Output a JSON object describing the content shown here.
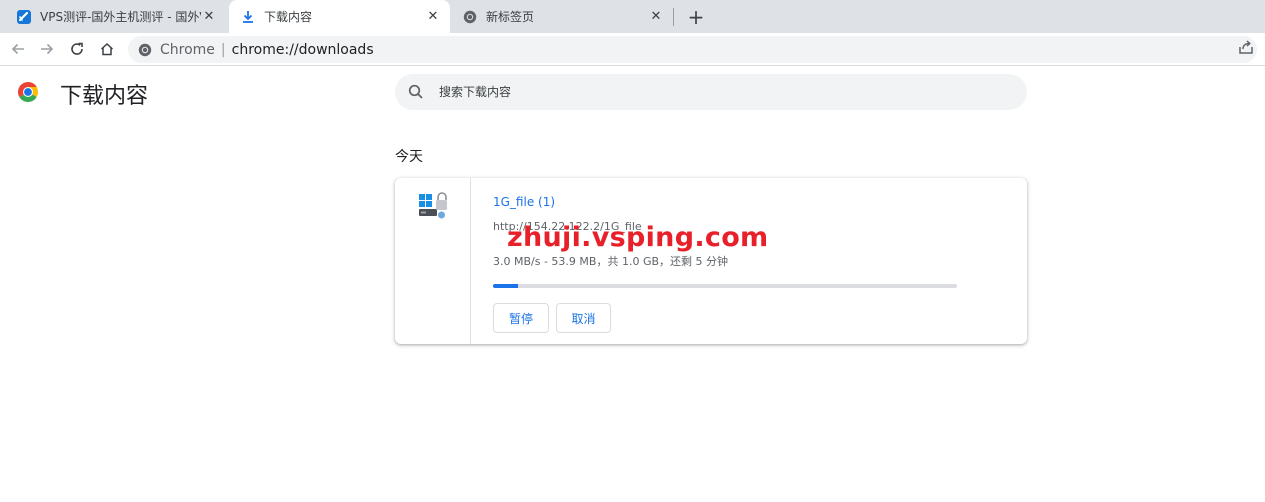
{
  "tabs": [
    {
      "title": "VPS测评-国外主机测评 - 国外VP",
      "close": "✕",
      "active": false
    },
    {
      "title": "下载内容",
      "close": "✕",
      "active": true
    },
    {
      "title": "新标签页",
      "close": "✕",
      "active": false
    }
  ],
  "newtab": "+",
  "omnibox": {
    "scheme": "Chrome",
    "divider": "|",
    "url": "chrome://downloads"
  },
  "page": {
    "title": "下载内容",
    "search_placeholder": "搜索下载内容",
    "date_header": "今天"
  },
  "download": {
    "file_name": "1G_file (1)",
    "url": "http://154.22.122.2/1G_file",
    "status": "3.0 MB/s - 53.9 MB，共 1.0 GB，还剩 5 分钟",
    "progress_fraction": 0.053,
    "pause_label": "暂停",
    "cancel_label": "取消"
  },
  "watermark": "zhuji.vsping.com",
  "colors": {
    "accent": "#1a73e8",
    "watermark": "#e8202a",
    "tabstrip": "#dee1e6"
  }
}
